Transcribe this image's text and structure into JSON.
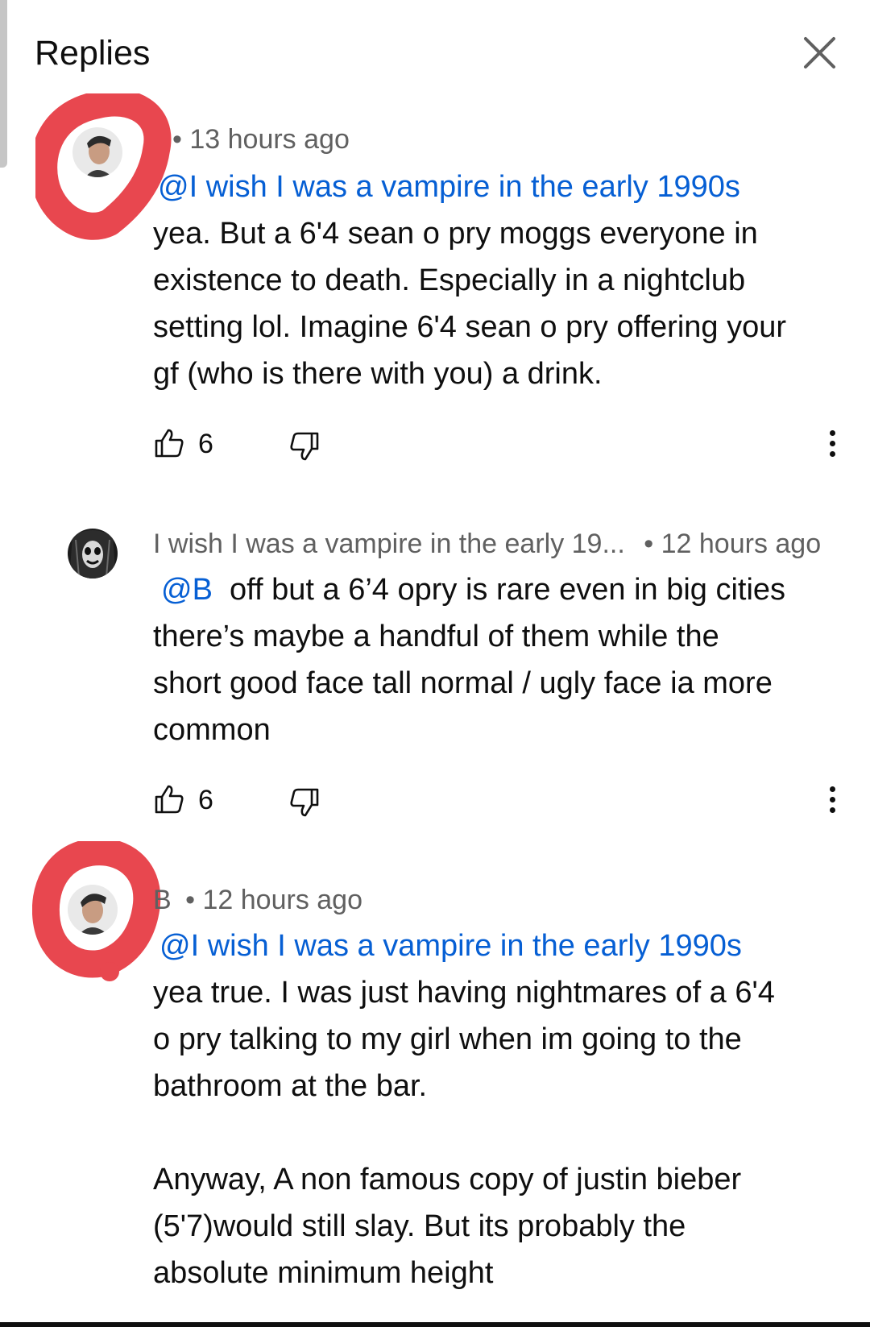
{
  "header": {
    "title": "Replies",
    "close_icon": "close-icon"
  },
  "colors": {
    "mention": "#065fd4",
    "meta": "#606060",
    "annotation": "#e8474f"
  },
  "comments": [
    {
      "author": "",
      "separator": "•",
      "time": "13 hours ago",
      "mention": "@I wish I was a vampire in the early 1990s",
      "text_lines": [
        "yea. But a 6'4 sean o pry moggs everyone in",
        "existence to death. Especially in a nightclub",
        "setting lol. Imagine  6'4 sean o pry offering your",
        "gf (who is there with you) a drink."
      ],
      "likes": "6",
      "avatar_icon": "profile-photo-icon"
    },
    {
      "author": "I wish I was a vampire in the early 19...",
      "separator": "•",
      "time": "12 hours ago",
      "mention": "@B",
      "mention_tail": "  off but a 6’4 opry is rare even in big cities",
      "text_lines": [
        "there’s maybe a handful of them while the",
        "short good face tall normal / ugly face ia more",
        "common"
      ],
      "likes": "6",
      "avatar_icon": "corpse-paint-face-icon"
    },
    {
      "author": "B",
      "separator": "•",
      "time": "12 hours ago",
      "mention": "@I wish I was a vampire in the early 1990s",
      "text_lines": [
        "yea true. I was just having nightmares of a 6'4",
        "o pry talking to my girl when im going to the",
        "bathroom at the bar.",
        "",
        "Anyway, A non famous copy of justin bieber",
        "(5'7)would still slay. But its probably the",
        "absolute minimum height"
      ],
      "avatar_icon": "profile-photo-icon"
    }
  ],
  "icons": {
    "like": "thumbs-up-icon",
    "dislike": "thumbs-down-icon",
    "more": "more-vertical-icon"
  }
}
